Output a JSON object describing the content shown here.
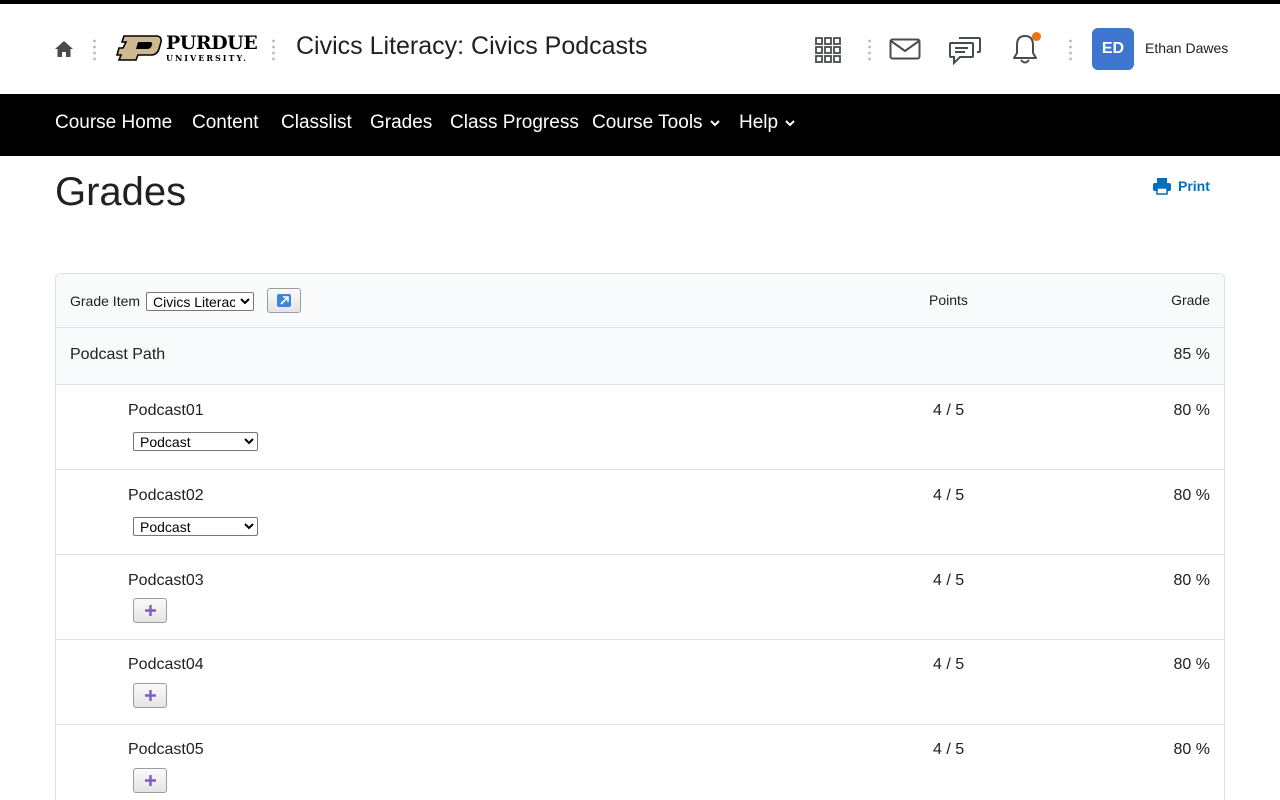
{
  "header": {
    "logo": {
      "name": "PURDUE",
      "sub": "UNIVERSITY."
    },
    "course_title": "Civics Literacy: Civics Podcasts",
    "icons": [
      "home-icon",
      "waffle-grid-icon",
      "mail-icon",
      "chat-icon",
      "bell-icon"
    ],
    "user_initials": "ED",
    "user_name": "Ethan Dawes",
    "avatar_color": "#3e75cf",
    "notification_color": "#e87511"
  },
  "nav": {
    "items": [
      {
        "label": "Course Home"
      },
      {
        "label": "Content"
      },
      {
        "label": "Classlist"
      },
      {
        "label": "Grades"
      },
      {
        "label": "Class Progress"
      },
      {
        "label": "Course Tools"
      },
      {
        "label": "Help"
      }
    ]
  },
  "page": {
    "title": "Grades",
    "print_label": "Print",
    "link_color": "#006fbf"
  },
  "table": {
    "grade_item_label": "Grade Item",
    "grade_item_selected": "Civics Literacy",
    "col_points": "Points",
    "col_grade": "Grade",
    "category": {
      "name": "Podcast Path",
      "grade": "85 %"
    },
    "rows": [
      {
        "name": "Podcast01",
        "points": "4 / 5",
        "grade": "80 %",
        "control": "select",
        "select_value": "Podcast"
      },
      {
        "name": "Podcast02",
        "points": "4 / 5",
        "grade": "80 %",
        "control": "select",
        "select_value": "Podcast"
      },
      {
        "name": "Podcast03",
        "points": "4 / 5",
        "grade": "80 %",
        "control": "add"
      },
      {
        "name": "Podcast04",
        "points": "4 / 5",
        "grade": "80 %",
        "control": "add"
      },
      {
        "name": "Podcast05",
        "points": "4 / 5",
        "grade": "80 %",
        "control": "add"
      }
    ]
  }
}
